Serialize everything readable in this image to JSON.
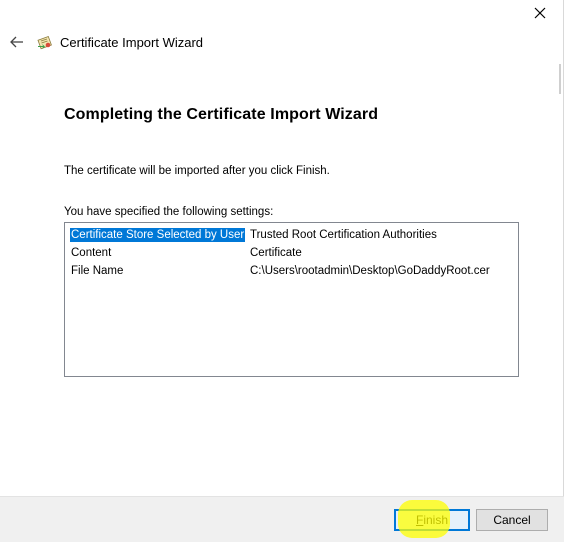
{
  "window": {
    "close_icon": "close-icon"
  },
  "header": {
    "back_icon": "arrow-left-icon",
    "app_icon": "certificate-icon",
    "title": "Certificate Import Wizard"
  },
  "main": {
    "heading": "Completing the Certificate Import Wizard",
    "info": "The certificate will be imported after you click Finish.",
    "settings_label": "You have specified the following settings:",
    "settings": [
      {
        "key": "Certificate Store Selected by User",
        "value": "Trusted Root Certification Authorities",
        "selected": true
      },
      {
        "key": "Content",
        "value": "Certificate",
        "selected": false
      },
      {
        "key": "File Name",
        "value": "C:\\Users\\rootadmin\\Desktop\\GoDaddyRoot.cer",
        "selected": false
      }
    ]
  },
  "footer": {
    "finish_label_mnemonic": "F",
    "finish_label_rest": "inish",
    "cancel_label": "Cancel"
  },
  "colors": {
    "selection": "#0078d7",
    "highlight": "#ffff00",
    "footer_bg": "#f0f0f0"
  }
}
